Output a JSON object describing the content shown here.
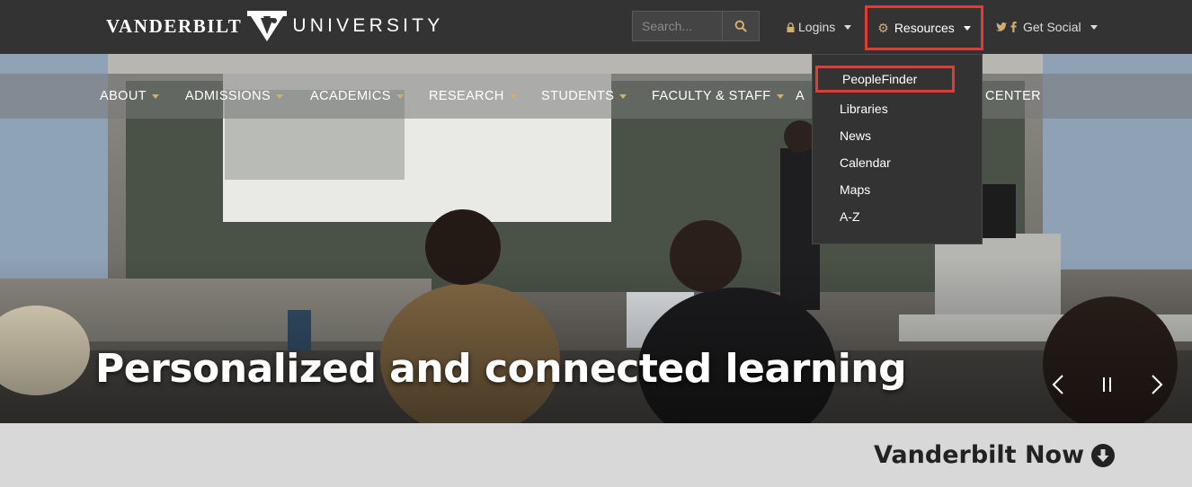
{
  "brand": {
    "name_left": "VANDERBILT",
    "name_right": "UNIVERSITY"
  },
  "search": {
    "placeholder": "Search...",
    "button_icon": "search-icon"
  },
  "utility_nav": {
    "logins": {
      "label": "Logins",
      "icon": "lock-icon"
    },
    "resources": {
      "label": "Resources",
      "icon": "gear-icon"
    },
    "social": {
      "label": "Get Social",
      "icons": [
        "twitter-icon",
        "facebook-icon"
      ]
    }
  },
  "main_nav": [
    {
      "label": "ABOUT"
    },
    {
      "label": "ADMISSIONS"
    },
    {
      "label": "ACADEMICS"
    },
    {
      "label": "RESEARCH"
    },
    {
      "label": "STUDENTS"
    },
    {
      "label": "FACULTY & STAFF"
    },
    {
      "label": "A"
    },
    {
      "label": "CENTER"
    }
  ],
  "resources_menu": [
    {
      "label": "PeopleFinder"
    },
    {
      "label": "Libraries"
    },
    {
      "label": "News"
    },
    {
      "label": "Calendar"
    },
    {
      "label": "Maps"
    },
    {
      "label": "A-Z"
    }
  ],
  "hero": {
    "headline": "Personalized and connected learning",
    "controls": [
      "chevron-left-icon",
      "pause-icon",
      "chevron-right-icon"
    ]
  },
  "section": {
    "title": "Vanderbilt Now",
    "icon": "arrow-down-circle-icon"
  },
  "colors": {
    "topbar": "#333333",
    "accent_gold": "#cfae70",
    "highlight_red": "#e53935",
    "band": "#d8d8d8"
  }
}
